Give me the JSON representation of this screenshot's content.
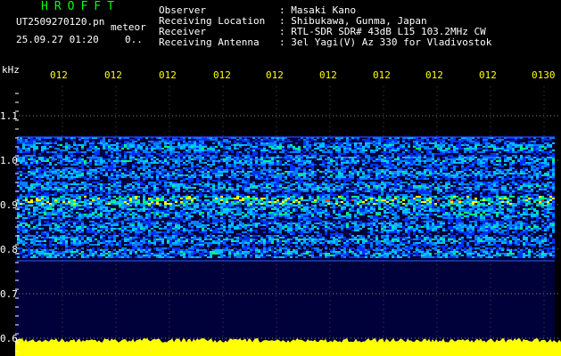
{
  "header": {
    "title": "HROFFT",
    "filename": "UT2509270120.pn",
    "meteor_label": "meteor",
    "datetime": "25.09.27 01:20",
    "score": "0..",
    "info": [
      {
        "label": "Observer",
        "value": ": Masaki Kano"
      },
      {
        "label": "Receiving Location",
        "value": ": Shibukawa, Gunma, Japan"
      },
      {
        "label": "Receiver",
        "value": ": RTL-SDR SDR# 43dB L15 103.2MHz CW"
      },
      {
        "label": "Receiving Antenna",
        "value": ": 3el Yagi(V) Az 330 for Vladivostok"
      }
    ]
  },
  "axes": {
    "unit": "kHz",
    "time_ticks": [
      "012",
      "012",
      "012",
      "012",
      "012",
      "012",
      "012",
      "012",
      "012",
      "0130"
    ],
    "freq_ticks": [
      "1.1",
      "1.0",
      "0.9",
      "0.8",
      "0.7",
      "0.6"
    ]
  },
  "colors": {
    "text": "#ffffff",
    "title": "#00ff00",
    "tick_labels": "#ffff00",
    "background": "#000000",
    "noise_floor": "#ffff00"
  }
}
